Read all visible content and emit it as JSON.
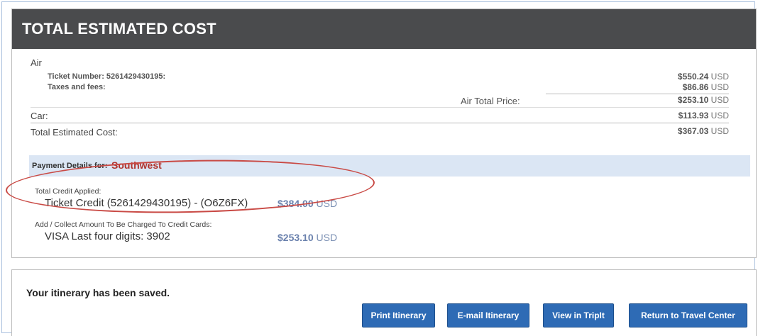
{
  "header": {
    "title": "TOTAL ESTIMATED COST"
  },
  "costs": {
    "air_label": "Air",
    "ticket_number_label": "Ticket Number: 5261429430195:",
    "ticket_amount": "$550.24",
    "taxes_label": "Taxes and fees:",
    "taxes_amount": "$86.86",
    "air_total_label": "Air Total Price:",
    "air_total_amount": "$253.10",
    "car_label": "Car:",
    "car_amount": "$113.93",
    "total_label": "Total Estimated Cost:",
    "total_amount": "$367.03",
    "currency": "USD"
  },
  "payment": {
    "details_label": "Payment Details for:",
    "vendor": "Southwest",
    "credit_applied_label": "Total Credit Applied:",
    "ticket_credit_label": "Ticket Credit (5261429430195) - (O6Z6FX)",
    "ticket_credit_amount": "$384.00",
    "collect_label": "Add / Collect Amount To Be Charged To Credit Cards:",
    "card_label": "VISA Last four digits: 3902",
    "card_amount": "$253.10",
    "currency": "USD"
  },
  "saved": {
    "message": "Your itinerary has been saved.",
    "buttons": {
      "print": "Print Itinerary",
      "email": "E-mail Itinerary",
      "tripit": "View in TripIt",
      "return": "Return to Travel Center"
    }
  },
  "colors": {
    "header_bg": "#4a4b4d",
    "payment_bar_bg": "#dbe6f4",
    "vendor_red": "#b0342e",
    "button_blue": "#2e6bb5",
    "annotation_ellipse": "#c94a45"
  }
}
